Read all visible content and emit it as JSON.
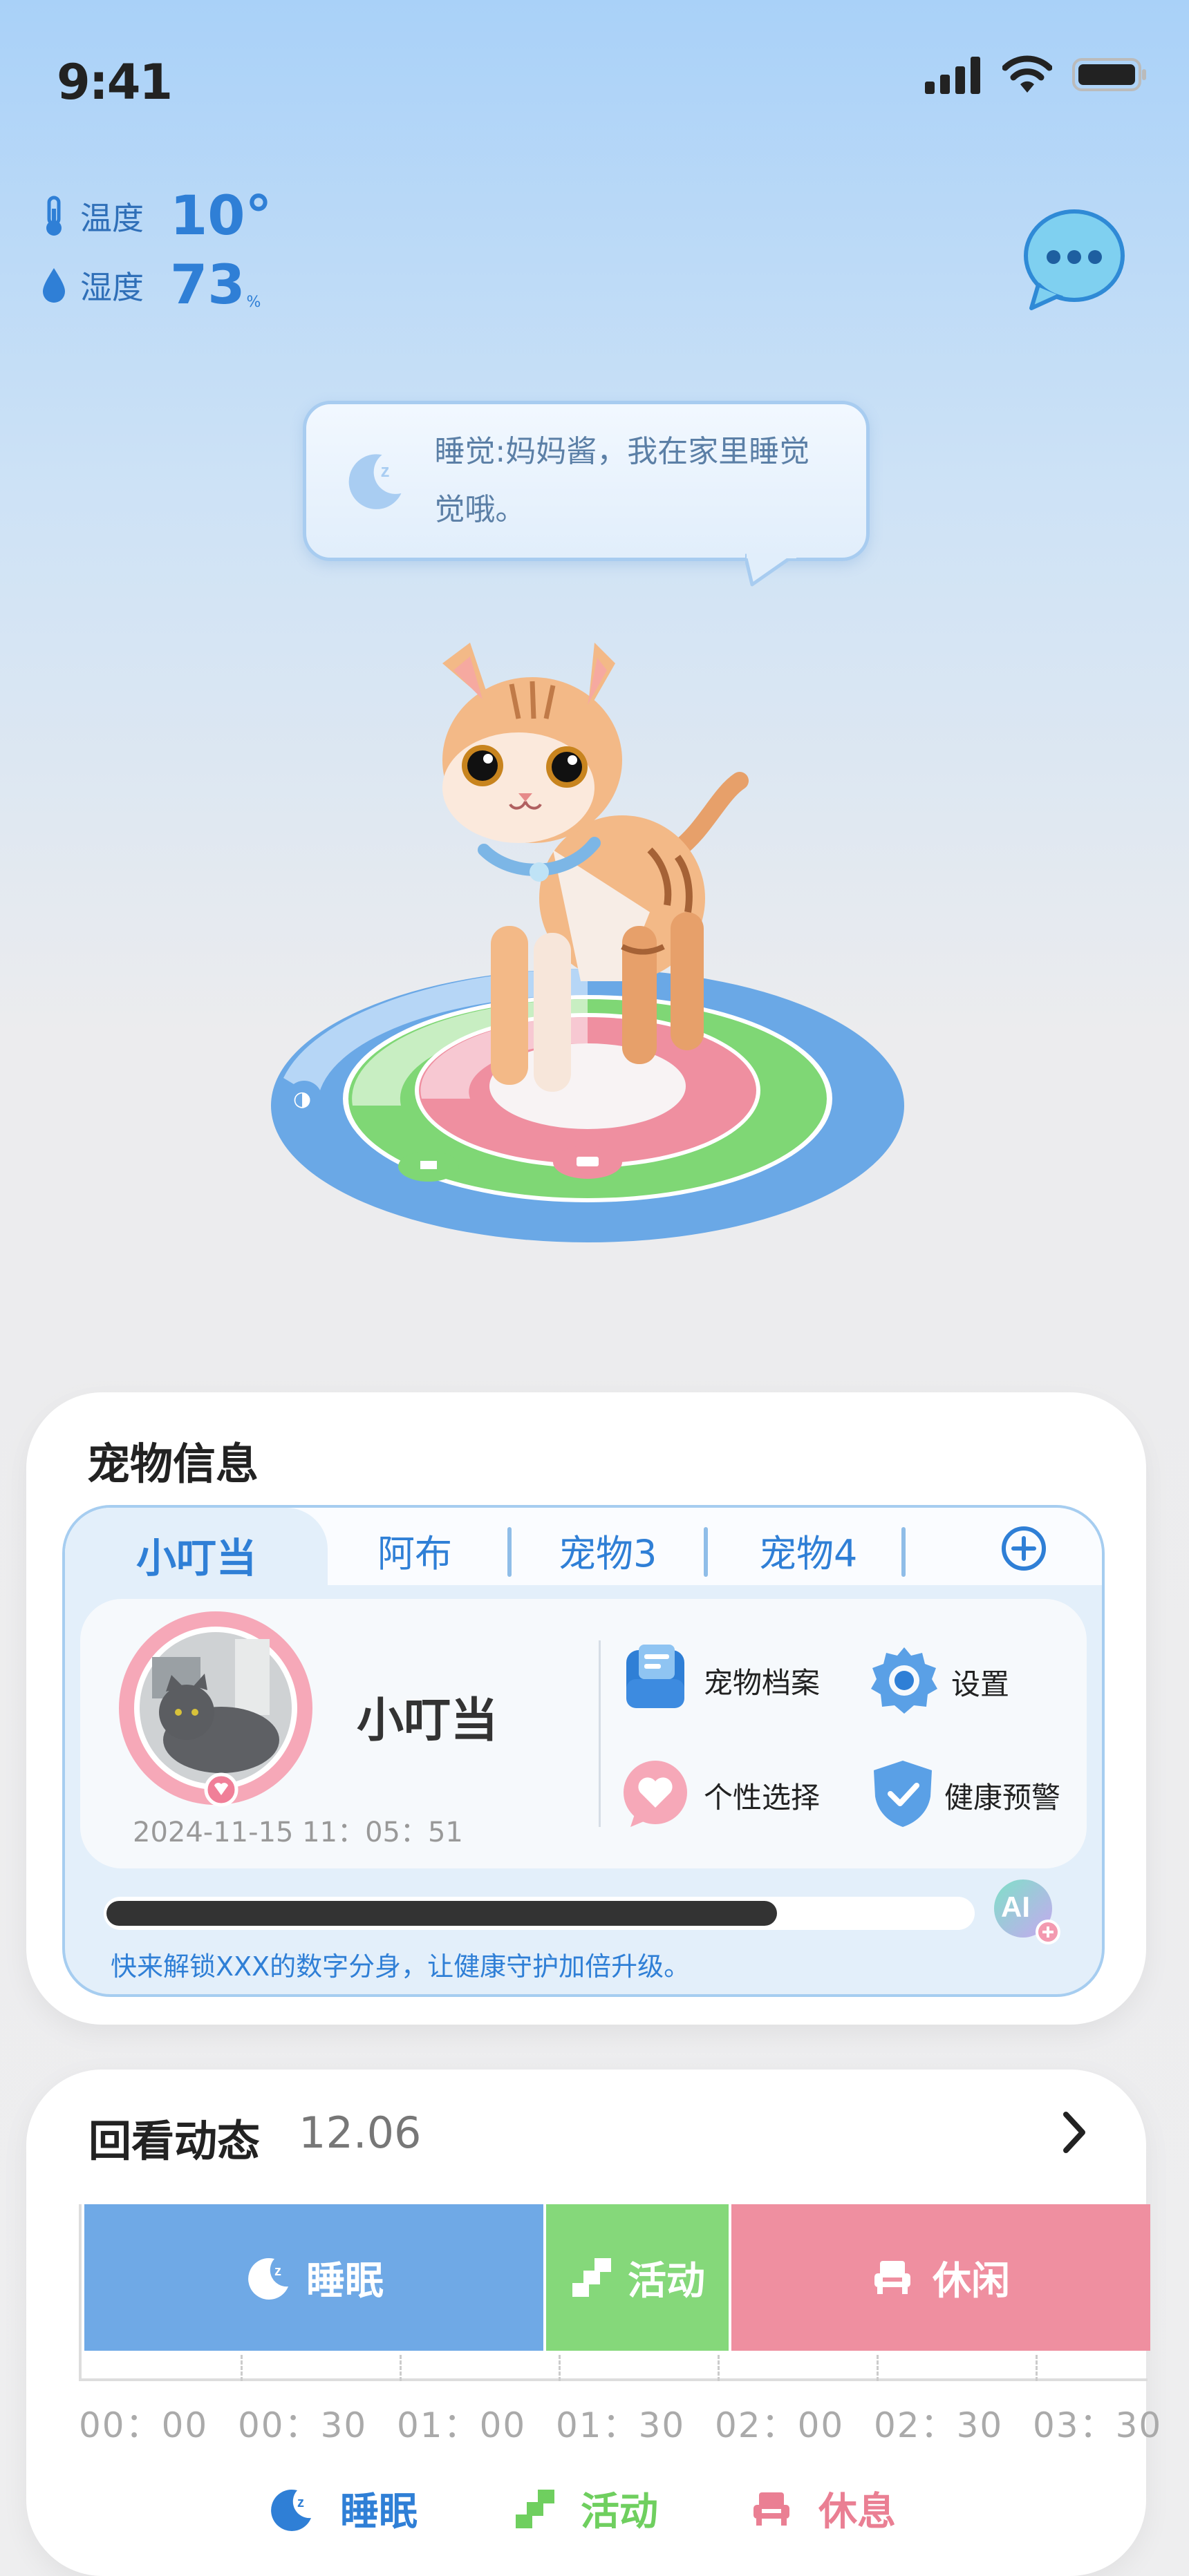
{
  "status": {
    "time": "9:41"
  },
  "env": {
    "temp_label": "温度",
    "temp_value": "10°",
    "humidity_label": "湿度",
    "humidity_value": "73",
    "humidity_unit": "%"
  },
  "bubble": {
    "text": "睡觉:妈妈酱，我在家里睡觉觉哦。"
  },
  "pet_card": {
    "title": "宠物信息",
    "tabs": [
      "小叮当",
      "阿布",
      "宠物3",
      "宠物4"
    ],
    "name": "小叮当",
    "date": "2024-11-15 11：05：51",
    "menu": [
      "宠物档案",
      "设置",
      "个性选择",
      "健康预警"
    ],
    "progress": 0.77,
    "ai_badge": "AI",
    "hint": "快来解锁XXX的数字分身，让健康守护加倍升级。"
  },
  "replay": {
    "title": "回看动态",
    "date": "12.06",
    "segments": [
      {
        "label": "睡眠",
        "color": "#6fa9e6",
        "icon": "moon-icon"
      },
      {
        "label": "活动",
        "color": "#85d87a",
        "icon": "stairs-icon"
      },
      {
        "label": "休闲",
        "color": "#ef8fa0",
        "icon": "sofa-icon"
      }
    ],
    "ticks": [
      "00：00",
      "00：30",
      "01：00",
      "01：30",
      "02：00",
      "02：30",
      "03：30"
    ],
    "legend": [
      {
        "label": "睡眠",
        "color": "#2f7fd6"
      },
      {
        "label": "活动",
        "color": "#6fcf5f"
      },
      {
        "label": "休息",
        "color": "#ea7f93"
      }
    ]
  },
  "colors": {
    "accent": "#2f7fd6",
    "sleep": "#6fa9e6",
    "activity": "#85d87a",
    "rest": "#ef8fa0"
  }
}
